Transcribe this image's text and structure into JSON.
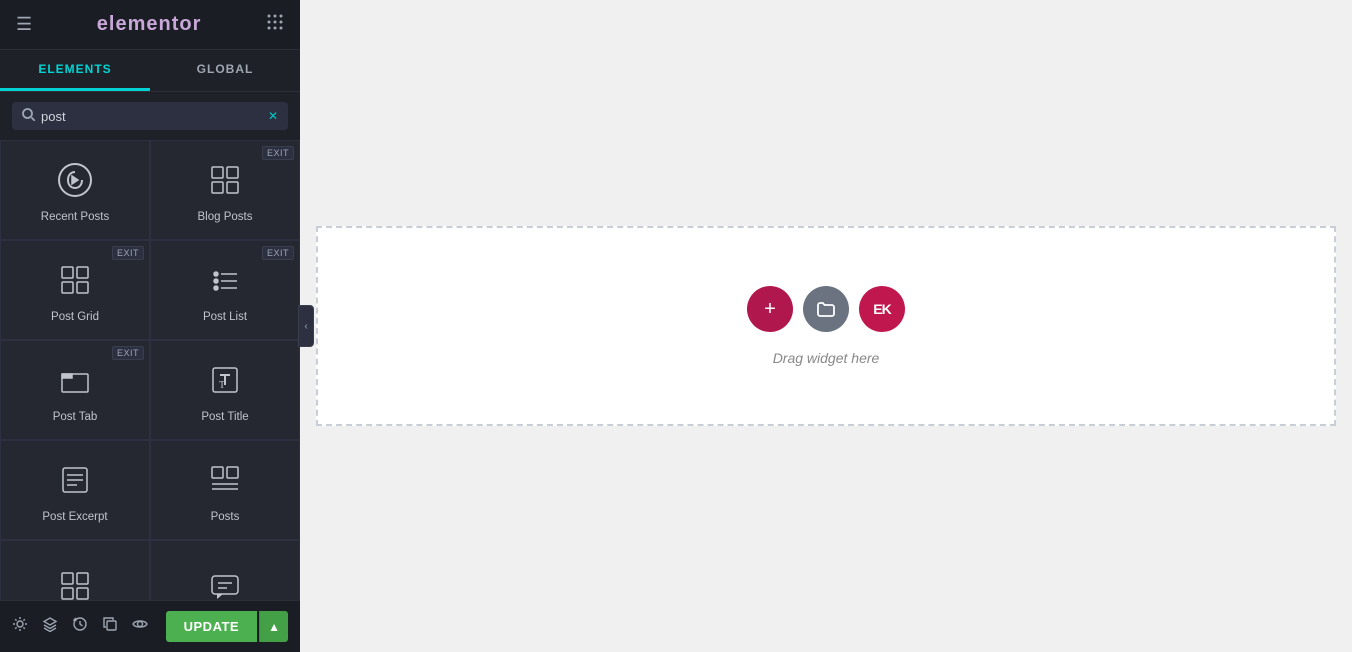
{
  "app": {
    "title": "elementor",
    "hamburger": "☰",
    "grid": "⠿"
  },
  "tabs": [
    {
      "id": "elements",
      "label": "ELEMENTS",
      "active": true
    },
    {
      "id": "global",
      "label": "GLOBAL",
      "active": false
    }
  ],
  "search": {
    "value": "post",
    "placeholder": "Search",
    "clear_label": "✕"
  },
  "widgets": [
    {
      "id": "recent-posts",
      "label": "Recent Posts",
      "icon": "wp",
      "has_exit": false
    },
    {
      "id": "blog-posts",
      "label": "Blog Posts",
      "icon": "grid4",
      "has_exit": true
    },
    {
      "id": "post-grid",
      "label": "Post Grid",
      "icon": "grid4",
      "has_exit": true
    },
    {
      "id": "post-list",
      "label": "Post List",
      "icon": "list",
      "has_exit": true
    },
    {
      "id": "post-tab",
      "label": "Post Tab",
      "icon": "tab",
      "has_exit": true
    },
    {
      "id": "post-title",
      "label": "Post Title",
      "icon": "ttitle",
      "has_exit": false
    },
    {
      "id": "post-excerpt",
      "label": "Post Excerpt",
      "icon": "excerpt",
      "has_exit": false
    },
    {
      "id": "posts",
      "label": "Posts",
      "icon": "posts",
      "has_exit": false
    },
    {
      "id": "widget-9",
      "label": "",
      "icon": "grid4",
      "has_exit": false
    },
    {
      "id": "widget-10",
      "label": "",
      "icon": "chat",
      "has_exit": false
    }
  ],
  "canvas": {
    "drag_hint": "Drag widget here"
  },
  "bottom_toolbar": {
    "icons": [
      "gear",
      "layers",
      "history",
      "clone",
      "eye"
    ],
    "update_label": "UPDATE",
    "dropdown_label": "▲"
  }
}
